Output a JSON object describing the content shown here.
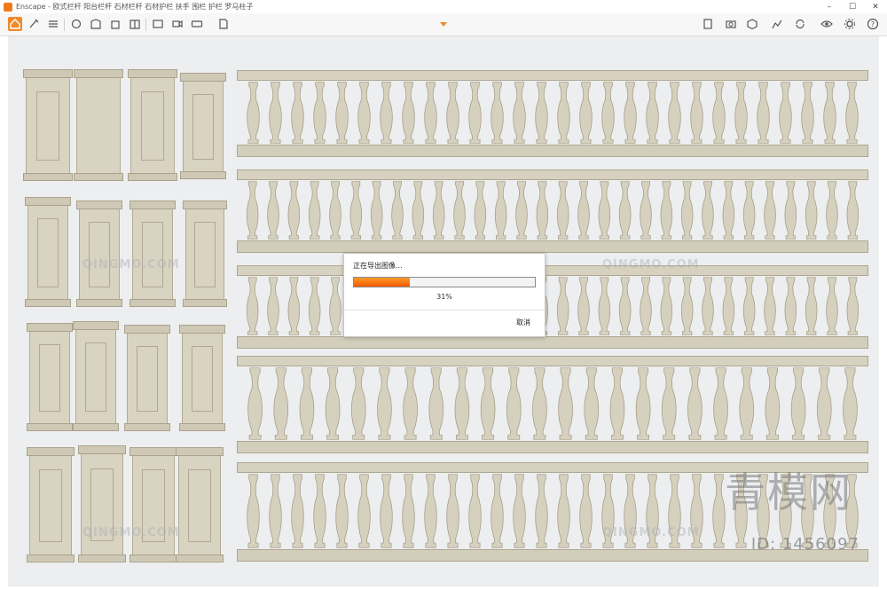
{
  "window": {
    "title": "Enscape - 欧式栏杆 阳台栏杆 石材栏杆 石材护栏 扶手 围栏 护栏 罗马柱子"
  },
  "toolbar": {
    "icons": [
      "home-icon",
      "brush-icon",
      "bim-icon",
      "list-icon",
      "asset-icon",
      "views-icon",
      "building-icon",
      "book-icon",
      "screenshot-icon",
      "video-icon",
      "panorama-icon",
      "export-icon",
      "vr-icon",
      "camera-icon",
      "cube-icon",
      "graph-icon",
      "sync-icon",
      "eye-icon",
      "settings-icon",
      "help-icon"
    ]
  },
  "dialog": {
    "title": "正在导出图像...",
    "progress": 0.31,
    "percent_label": "31%",
    "cancel_label": "取消"
  },
  "watermarks": {
    "site": "QINGMO.COM",
    "brand": "青模网",
    "id": "ID: 1456097"
  },
  "colors": {
    "accent": "#f08a2a",
    "progress_start": "#ff9a2a",
    "progress_end": "#f25a00",
    "stone": "#d9d3c2"
  }
}
